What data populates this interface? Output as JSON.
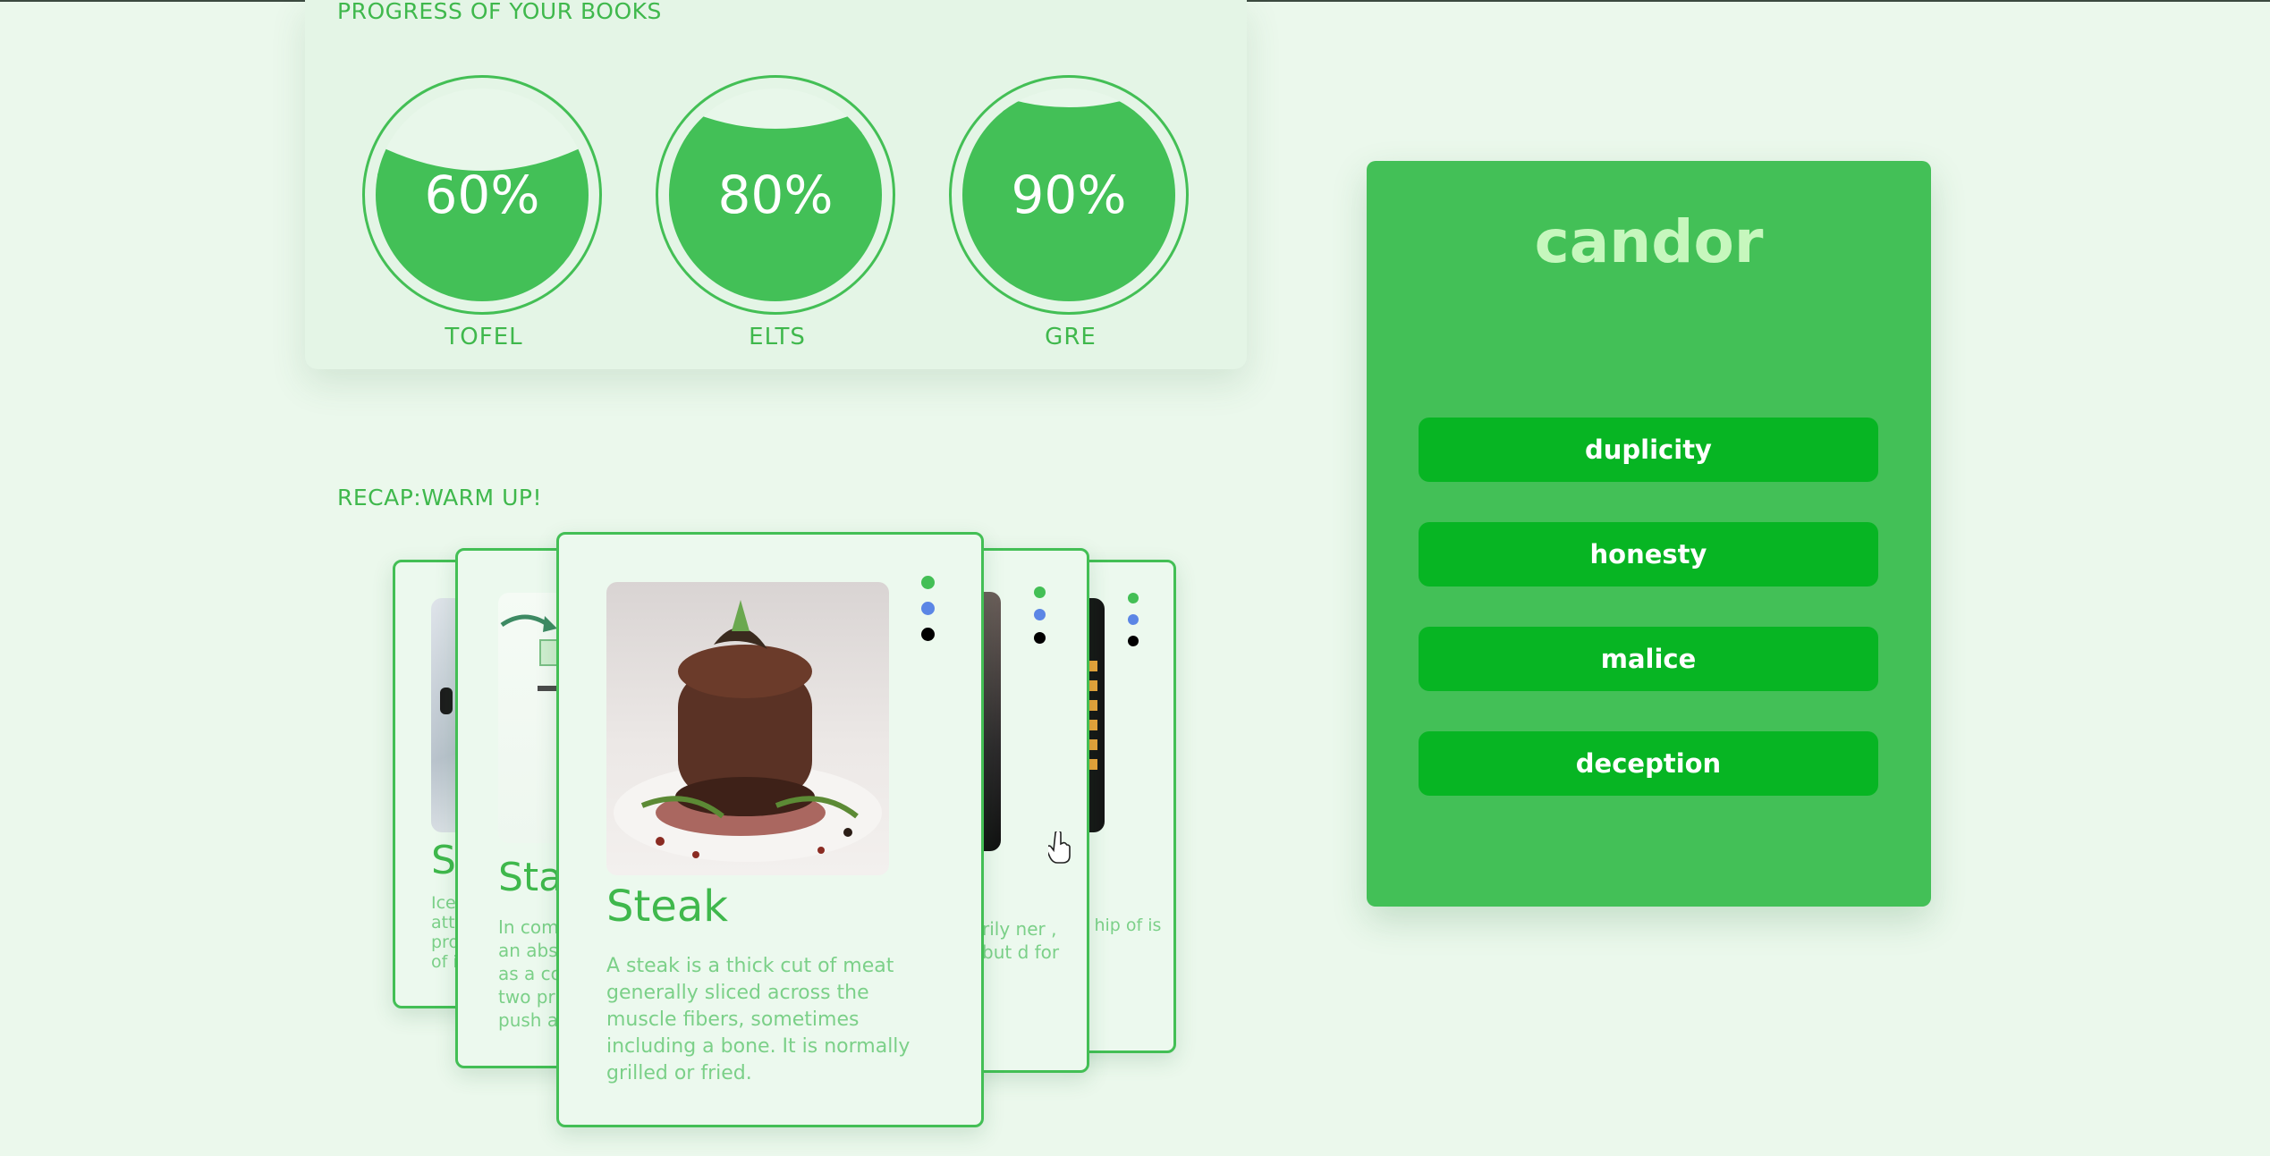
{
  "progress": {
    "title": "PROGRESS OF YOUR BOOKS",
    "books": [
      {
        "label": "TOFEL",
        "percent_text": "60%",
        "value": 0.6
      },
      {
        "label": "ELTS",
        "percent_text": "80%",
        "value": 0.8
      },
      {
        "label": "GRE",
        "percent_text": "90%",
        "value": 0.9
      }
    ]
  },
  "recap": {
    "title": "RECAP:WARM UP!",
    "cards": {
      "far_left": {
        "title": "Sl",
        "desc": "Ice att pro of i"
      },
      "left": {
        "title": "Stac",
        "desc": "In com an abst as a co two pri push a"
      },
      "front": {
        "title": "Steak",
        "desc": "A steak is a thick cut of meat generally sliced across the muscle fibers, sometimes including a bone. It is normally grilled or fried."
      },
      "right": {
        "desc": "rily ner , but d for"
      },
      "far_right": {
        "desc": "/, hip of is"
      }
    },
    "dot_colors": [
      "#43bf55",
      "#5b86e5",
      "#000000"
    ]
  },
  "quiz": {
    "word": "candor",
    "options": [
      "duplicity",
      "honesty",
      "malice",
      "deception"
    ]
  },
  "colors": {
    "accent": "#43c057",
    "option_bg": "#07b523",
    "page_bg": "#ebf8ec"
  }
}
